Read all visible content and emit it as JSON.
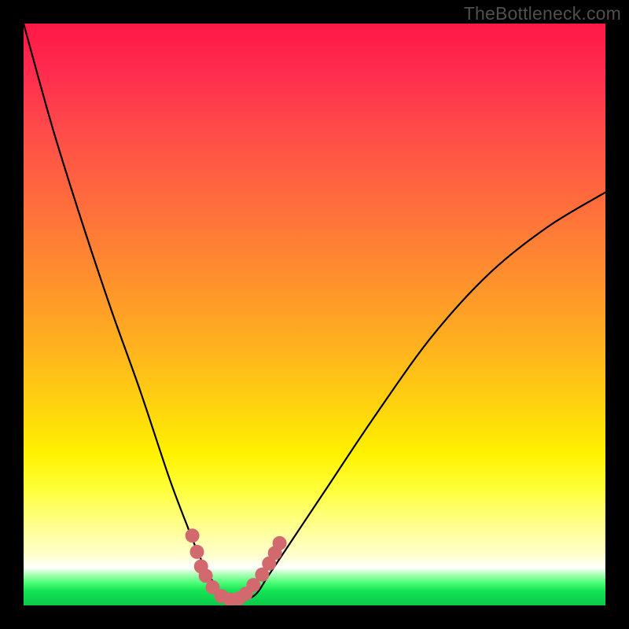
{
  "watermark": "TheBottleneck.com",
  "colors": {
    "curve_stroke": "#000000",
    "dot_fill": "#d1696f",
    "frame_bg": "#000000",
    "gradient_stops": [
      {
        "offset": 0,
        "color": "#ff1846"
      },
      {
        "offset": 0.3,
        "color": "#ff6a3d"
      },
      {
        "offset": 0.55,
        "color": "#ffb01f"
      },
      {
        "offset": 0.74,
        "color": "#fff200"
      },
      {
        "offset": 0.935,
        "color": "#ffffff"
      },
      {
        "offset": 0.96,
        "color": "#52ff7a"
      },
      {
        "offset": 1.0,
        "color": "#0bc94a"
      }
    ]
  },
  "chart_data": {
    "type": "line",
    "title": "",
    "xlabel": "",
    "ylabel": "",
    "xlim": [
      0,
      100
    ],
    "ylim": [
      0,
      100
    ],
    "legend": false,
    "grid": false,
    "curve": {
      "name": "bottleneck-curve",
      "x": [
        0,
        5,
        10,
        15,
        20,
        25,
        28,
        30,
        32,
        34,
        36,
        38,
        40,
        42,
        46,
        52,
        60,
        70,
        80,
        90,
        100
      ],
      "y": [
        100,
        82,
        66,
        51,
        37,
        22,
        14,
        9,
        5,
        2,
        1,
        1,
        2,
        5,
        11,
        20,
        32,
        46,
        57,
        65,
        71
      ]
    },
    "points": {
      "name": "highlight-dots",
      "x": [
        29.0,
        29.8,
        30.5,
        31.3,
        32.5,
        34.0,
        35.5,
        37.0,
        38.2,
        39.5,
        41.0,
        42.2,
        43.2,
        44.0
      ],
      "y": [
        12.0,
        9.2,
        6.7,
        5.1,
        3.1,
        1.6,
        1.0,
        1.2,
        2.0,
        3.5,
        5.3,
        7.2,
        9.0,
        10.7
      ]
    }
  }
}
